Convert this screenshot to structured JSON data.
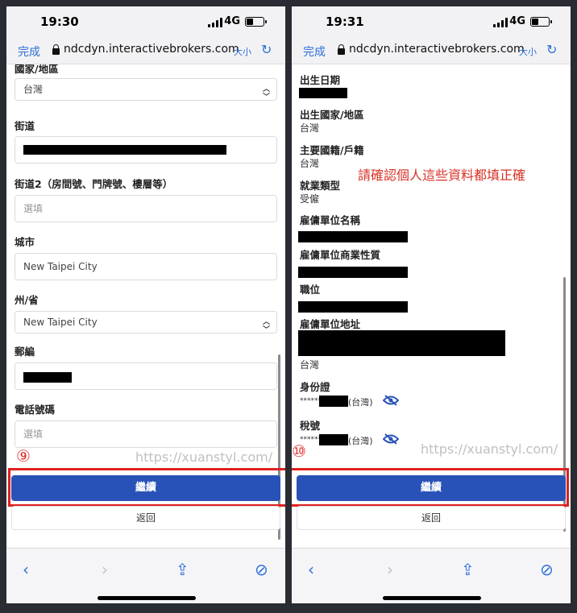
{
  "left": {
    "status": {
      "time": "19:30",
      "network": "4G"
    },
    "browser": {
      "done": "完成",
      "url": "ndcdyn.interactivebrokers.com",
      "text_size": "大小"
    },
    "form": {
      "country_label": "國家/地區",
      "country_value": "台灣",
      "street_label": "街道",
      "street2_label": "街道2（房間號、門牌號、樓層等）",
      "street2_placeholder": "選填",
      "city_label": "城市",
      "city_value": "New Taipei City",
      "state_label": "州/省",
      "state_value": "New Taipei City",
      "postal_label": "郵編",
      "phone_label": "電話號碼",
      "phone_placeholder": "選填"
    },
    "step_number": "⑨",
    "watermark": "https://xuanstyl.com/",
    "continue_label": "繼續",
    "back_label": "返回"
  },
  "right": {
    "status": {
      "time": "19:31",
      "network": "4G"
    },
    "browser": {
      "done": "完成",
      "url": "ndcdyn.interactivebrokers.com",
      "text_size": "大小"
    },
    "review": {
      "birthdate_label": "出生日期",
      "birth_country_label": "出生國家/地區",
      "birth_country_value": "台灣",
      "citizenship_label": "主要國籍/戶籍",
      "citizenship_value": "台灣",
      "employment_type_label": "就業類型",
      "employment_type_value": "受僱",
      "employer_name_label": "雇傭單位名稱",
      "employer_business_label": "雇傭單位商業性質",
      "position_label": "職位",
      "employer_address_label": "雇傭單位地址",
      "employer_address_country": "台灣",
      "id_label": "身份證",
      "id_masked": "******",
      "id_country": "(台灣)",
      "tax_label": "稅號",
      "tax_masked": "******",
      "tax_country": "(台灣)"
    },
    "annotation": "請確認個人這些資料都填正確",
    "step_number": "⑩",
    "watermark": "https://xuanstyl.com/",
    "continue_label": "繼續",
    "back_label": "返回"
  },
  "colors": {
    "accent": "#2e6fd8",
    "button": "#2952b8",
    "highlight": "#e02020",
    "annotation": "#d93025"
  }
}
